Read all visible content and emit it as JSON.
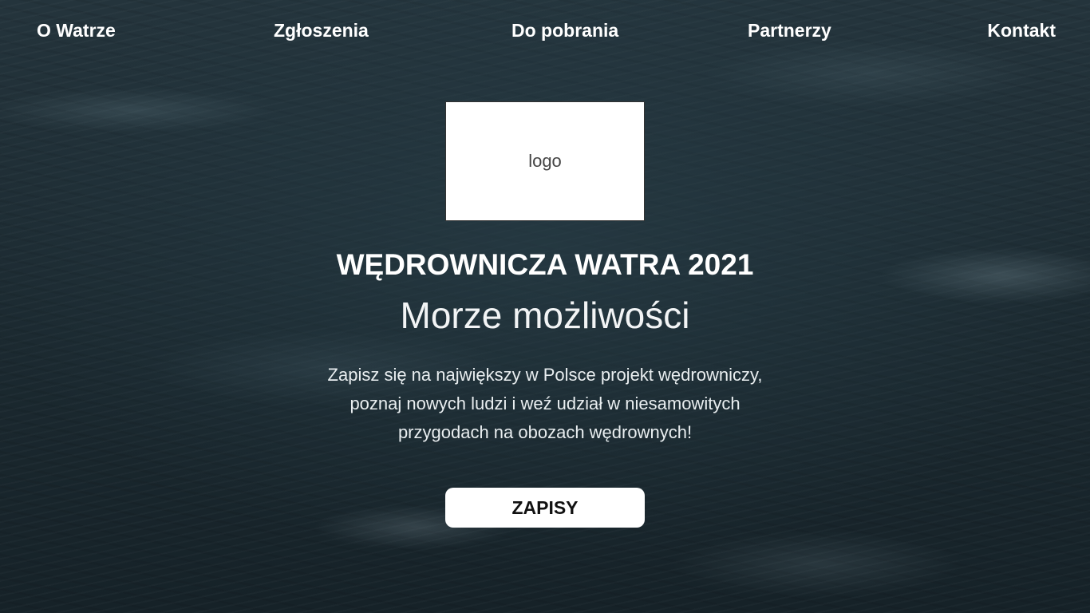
{
  "nav": {
    "items": [
      {
        "label": "O Watrze"
      },
      {
        "label": "Zgłoszenia"
      },
      {
        "label": "Do pobrania"
      },
      {
        "label": "Partnerzy"
      },
      {
        "label": "Kontakt"
      }
    ]
  },
  "hero": {
    "logo_placeholder": "logo",
    "title": "WĘDROWNICZA WATRA 2021",
    "subtitle": "Morze możliwości",
    "description": "Zapisz się na największy w Polsce projekt wędrowniczy, poznaj nowych ludzi i weź udział w niesamowitych przygodach na obozach wędrownych!",
    "cta_label": "ZAPISY"
  },
  "colors": {
    "background": "#1f2e36",
    "text": "#ffffff",
    "button_bg": "#ffffff",
    "button_text": "#111111"
  }
}
